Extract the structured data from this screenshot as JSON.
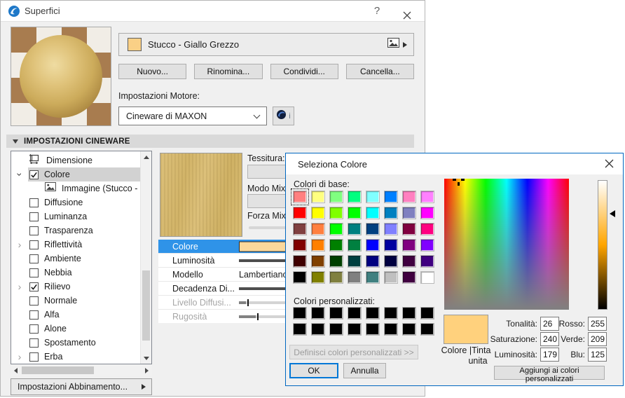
{
  "window": {
    "title": "Superfici",
    "help_glyph": "?",
    "material": {
      "name": "Stucco - Giallo Grezzo",
      "swatch_color": "#FAD086"
    },
    "action_buttons": [
      {
        "name": "new-button",
        "label": "Nuovo..."
      },
      {
        "name": "rename-button",
        "label": "Rinomina..."
      },
      {
        "name": "share-button",
        "label": "Condividi..."
      },
      {
        "name": "delete-button",
        "label": "Cancella..."
      }
    ],
    "engine": {
      "label": "Impostazioni Motore:",
      "value": "Cineware di MAXON",
      "info_glyph": "i"
    },
    "section_header": "IMPOSTAZIONI CINEWARE",
    "tree": {
      "items": [
        {
          "label": "Dimensione",
          "icon": "dimension"
        },
        {
          "label": "Colore",
          "expander": "open",
          "checkbox": true,
          "checked": true,
          "selected": true
        },
        {
          "label": "Immagine (Stucco - Giallo",
          "icon": "image",
          "indent": 1
        },
        {
          "label": "Diffusione",
          "checkbox": true
        },
        {
          "label": "Luminanza",
          "checkbox": true
        },
        {
          "label": "Trasparenza",
          "checkbox": true
        },
        {
          "label": "Riflettività",
          "expander": "closed",
          "checkbox": true
        },
        {
          "label": "Ambiente",
          "checkbox": true
        },
        {
          "label": "Nebbia",
          "checkbox": true
        },
        {
          "label": "Rilievo",
          "expander": "closed",
          "checkbox": true,
          "checked": true
        },
        {
          "label": "Normale",
          "checkbox": true
        },
        {
          "label": "Alfa",
          "checkbox": true
        },
        {
          "label": "Alone",
          "checkbox": true
        },
        {
          "label": "Spostamento",
          "checkbox": true
        },
        {
          "label": "Erba",
          "expander": "closed",
          "checkbox": true
        }
      ]
    },
    "match_settings_button": "Impostazioni Abbinamento...",
    "texture_panel": {
      "texture_label": "Tessitura:",
      "mix_mode_label": "Modo Mix",
      "mix_strength_label": "Forza Mix:"
    },
    "properties": {
      "rows": [
        {
          "label": "Colore",
          "type": "swatch",
          "swatch_color": "#FBD89B",
          "selected": true
        },
        {
          "label": "Luminosità",
          "type": "slider",
          "fill_pct": 40
        },
        {
          "label": "Modello",
          "type": "value",
          "value": "Lambertiano"
        },
        {
          "label": "Decadenza Di...",
          "type": "slider",
          "fill_pct": 40
        },
        {
          "label": "Livello Diffusi...",
          "type": "slider",
          "fill_pct": 4,
          "tick_pct": 5,
          "disabled": true
        },
        {
          "label": "Rugosità",
          "type": "slider",
          "fill_pct": 10,
          "tick_pct": 11,
          "disabled": true
        }
      ]
    }
  },
  "color_dialog": {
    "title": "Seleziona Colore",
    "basic_colors_label": "Colori di base:",
    "custom_colors_label": "Colori personalizzati:",
    "basic_colors": [
      "#FF8080",
      "#FFFF80",
      "#80FF80",
      "#00FF80",
      "#80FFFF",
      "#0080FF",
      "#FF80C0",
      "#FF80FF",
      "#FF0000",
      "#FFFF00",
      "#80FF00",
      "#00FF00",
      "#00FFFF",
      "#0080C0",
      "#8080C0",
      "#FF00FF",
      "#804040",
      "#FF8040",
      "#00FF00",
      "#008080",
      "#004080",
      "#8080FF",
      "#800040",
      "#FF0080",
      "#800000",
      "#FF8000",
      "#008000",
      "#008040",
      "#0000FF",
      "#0000A0",
      "#800080",
      "#8000FF",
      "#400000",
      "#804000",
      "#004000",
      "#004040",
      "#000080",
      "#000040",
      "#400040",
      "#400080",
      "#000000",
      "#808000",
      "#808040",
      "#808080",
      "#408080",
      "#C0C0C0",
      "#400040",
      "#FFFFFF"
    ],
    "selected_basic_index": 0,
    "custom_colors": [
      "#000000",
      "#000000",
      "#000000",
      "#000000",
      "#000000",
      "#000000",
      "#000000",
      "#000000",
      "#000000",
      "#000000",
      "#000000",
      "#000000",
      "#000000",
      "#000000",
      "#000000",
      "#000000"
    ],
    "define_custom_button": "Definisci colori personalizzati >>",
    "ok_button": "OK",
    "cancel_button": "Annulla",
    "add_custom_button": "Aggiungi ai colori personalizzati",
    "preview": {
      "color": "#FFD17D",
      "label_line1": "Colore  |Tinta",
      "label_line2": "unita"
    },
    "hsl_fields": [
      {
        "name": "hue-field",
        "label": "Tonalità:",
        "value": "26"
      },
      {
        "name": "saturation-field",
        "label": "Saturazione:",
        "value": "240"
      },
      {
        "name": "luminance-field",
        "label": "Luminosità:",
        "value": "179"
      }
    ],
    "rgb_fields": [
      {
        "name": "red-field",
        "label": "Rosso:",
        "value": "255"
      },
      {
        "name": "green-field",
        "label": "Verde:",
        "value": "209"
      },
      {
        "name": "blue-field",
        "label": "Blu:",
        "value": "125"
      }
    ]
  },
  "colors": {
    "accent": "#0078D7",
    "selected_row": "#2F93E8",
    "dialog_border": "#0067C0"
  }
}
